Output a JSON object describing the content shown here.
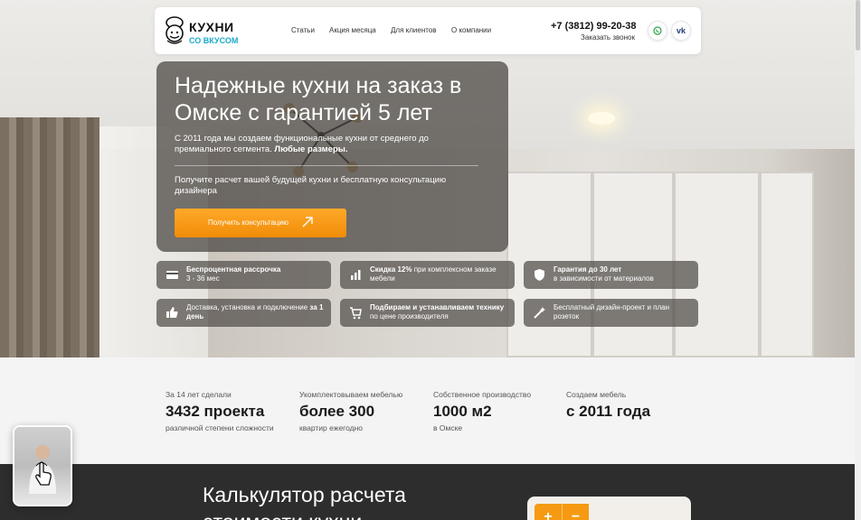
{
  "header": {
    "logo_title": "КУХНИ",
    "logo_sub": "СО ВКУСОМ",
    "nav": [
      "Статьи",
      "Акция месяца",
      "Для клиентов",
      "О компании"
    ],
    "phone": "+7 (3812) 99-20-38",
    "callback": "Заказать звонок",
    "social": {
      "whatsapp": "whatsapp-icon",
      "vk_label": "vk"
    }
  },
  "hero": {
    "title": "Надежные кухни на заказ в Омске с гарантией 5 лет",
    "sub_plain": "С 2011 года мы создаем функциональные кухни от среднего до премиального сегмента. ",
    "sub_bold": "Любые размеры.",
    "note": "Получите расчет вашей будущей кухни и бесплатную консультацию дизайнера",
    "cta": "Получить консультацию"
  },
  "features": [
    {
      "bold": "Беспроцентная рассрочка",
      "text": "3 - 36 мес",
      "icon": "card-icon"
    },
    {
      "bold": "Скидка 12%",
      "text": " при комплексном заказе мебели",
      "icon": "chart-icon"
    },
    {
      "bold": "Гарантия до 30 лет",
      "text": "в зависимости от материалов",
      "icon": "shield-icon"
    },
    {
      "pre": "Доставка, установка и подключение ",
      "bold": "за 1 день",
      "icon": "thumb-icon"
    },
    {
      "bold": "Подбираем и устанавливаем технику",
      "text": " по цене производителя",
      "icon": "cart-icon"
    },
    {
      "text": "Бесплатный дизайн-проект и план розеток",
      "icon": "wand-icon"
    }
  ],
  "stats": [
    {
      "cap": "За 14 лет сделали",
      "big": "3432 проекта",
      "sm": "различной степени сложности"
    },
    {
      "cap": "Укомплектовываем мебелью",
      "big": "более 300",
      "sm": "квартир ежегодно"
    },
    {
      "cap": "Собственное производство",
      "big": "1000 м2",
      "sm": "в Омске"
    },
    {
      "cap": "Создаем мебель",
      "big": "с 2011 года",
      "sm": ""
    }
  ],
  "calc": {
    "title": "Калькулятор расчета стоимости кухни",
    "plus": "+",
    "minus": "−"
  },
  "colors": {
    "accent": "#f59a12",
    "brand_blue": "#1ba9c9",
    "dark": "#2d2d2d"
  }
}
